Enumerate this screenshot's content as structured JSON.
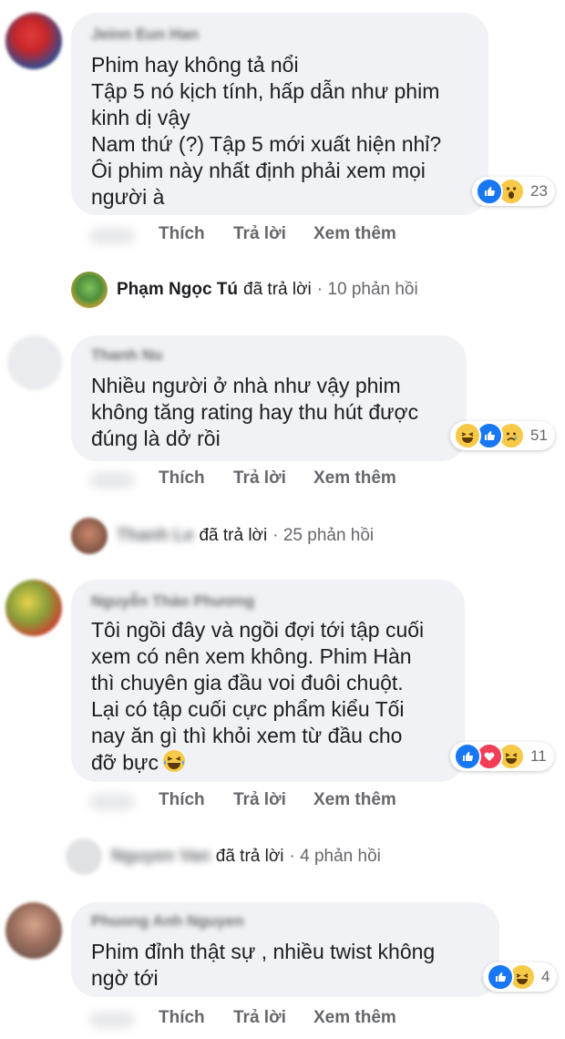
{
  "actions": {
    "like": "Thích",
    "reply": "Trả lời",
    "more": "Xem thêm"
  },
  "comments": [
    {
      "author": "Jeinn Eun Han",
      "lines": [
        "Phim hay không tả nổi",
        "Tập 5 nó kịch tính, hấp dẫn như phim",
        "kinh dị vậy",
        "Nam thứ (?) Tập 5 mới xuất hiện nhỉ?",
        "Ôi phim này nhất định phải xem mọi",
        "người à"
      ],
      "reactions": [
        "like-icon",
        "wow-icon"
      ],
      "reaction_count": "23",
      "reply_summary": {
        "name": "Phạm Ngọc Tú",
        "verb": "đã trả lời",
        "count": "· 10 phản hồi"
      }
    },
    {
      "author": "Thanh Nu",
      "lines": [
        "Nhiều người ở nhà như vậy phim",
        "không tăng rating hay thu hút được",
        "đúng là dở rồi"
      ],
      "reactions": [
        "haha-icon",
        "like-icon",
        "sad-icon"
      ],
      "reaction_count": "51",
      "reply_summary": {
        "name": "Thanh Le",
        "verb": "đã trả lời",
        "count": "· 25 phản hồi"
      }
    },
    {
      "author": "Nguyễn Thảo Phương",
      "lines": [
        "Tôi ngồi đây và ngồi đợi tới tập cuối",
        "xem có nên xem không. Phim Hàn",
        "thì chuyên gia đầu voi đuôi chuột.",
        "Lại có tập cuối cực phẩm kiểu Tối",
        "nay ăn gì thì khỏi xem từ đầu cho",
        "đỡ bực"
      ],
      "reactions": [
        "like-icon",
        "love-icon",
        "haha-icon"
      ],
      "reaction_count": "11",
      "reply_summary": {
        "name": "Nguyen Van",
        "verb": "đã trả lời",
        "count": "· 4 phản hồi"
      }
    },
    {
      "author": "Phuong Anh Nguyen",
      "lines": [
        "Phim đỉnh thật sự , nhiều twist không",
        "ngờ tới"
      ],
      "reactions": [
        "like-icon",
        "haha-icon"
      ],
      "reaction_count": "4"
    }
  ],
  "colors": {
    "like": "#1877f2",
    "love": "#f33e58",
    "emoji": "#f7c948",
    "bubble": "#f0f2f5",
    "meta": "#65676b"
  }
}
